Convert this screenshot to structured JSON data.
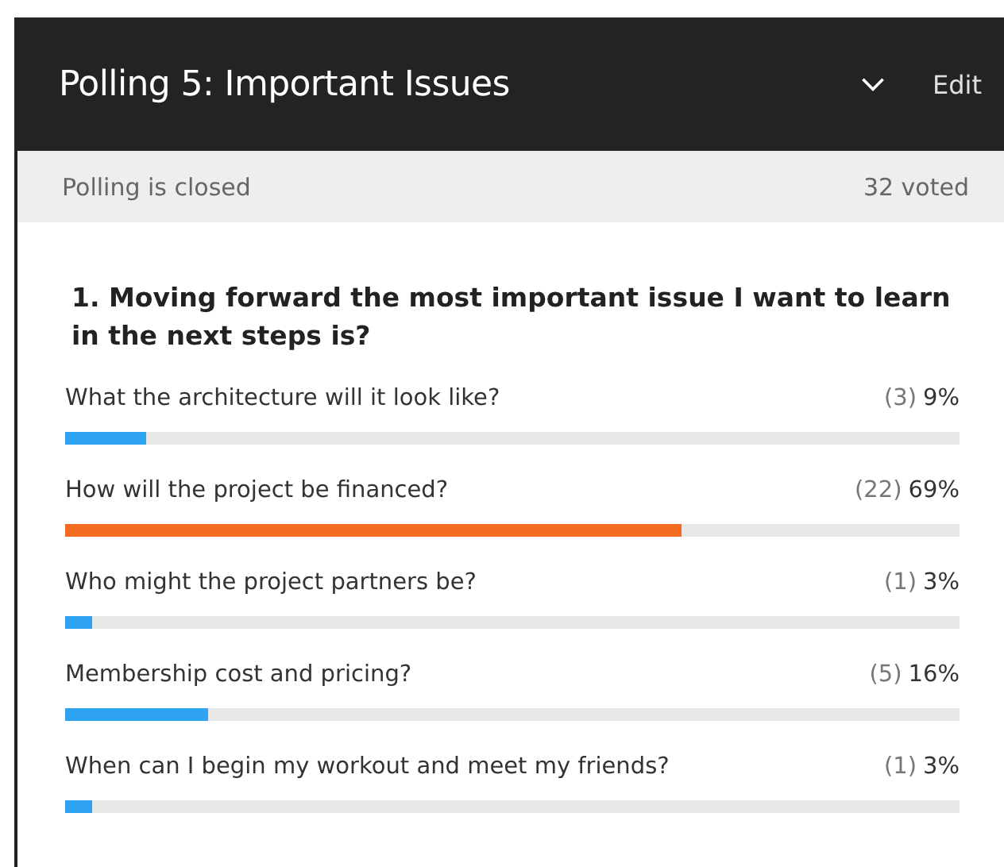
{
  "header": {
    "title": "Polling 5: Important Issues",
    "edit": "Edit"
  },
  "status_bar": {
    "state": "Polling is closed",
    "voted": "32 voted"
  },
  "question": "1. Moving forward the most important issue I want to learn in the next steps is?",
  "options": [
    {
      "label": "What the architecture will it look like?",
      "count": "(3)",
      "percent": "9%",
      "level": 0.09,
      "color": "#2ea3f2"
    },
    {
      "label": "How will the project be financed?",
      "count": "(22)",
      "percent": "69%",
      "level": 0.69,
      "color": "#f26b21"
    },
    {
      "label": "Who might the project partners be?",
      "count": "(1)",
      "percent": "3%",
      "level": 0.03,
      "color": "#2ea3f2"
    },
    {
      "label": "Membership cost and pricing?",
      "count": "(5)",
      "percent": "16%",
      "level": 0.16,
      "color": "#2ea3f2"
    },
    {
      "label": "When can I begin my workout and meet my friends?",
      "count": "(1)",
      "percent": "3%",
      "level": 0.03,
      "color": "#2ea3f2"
    }
  ]
}
